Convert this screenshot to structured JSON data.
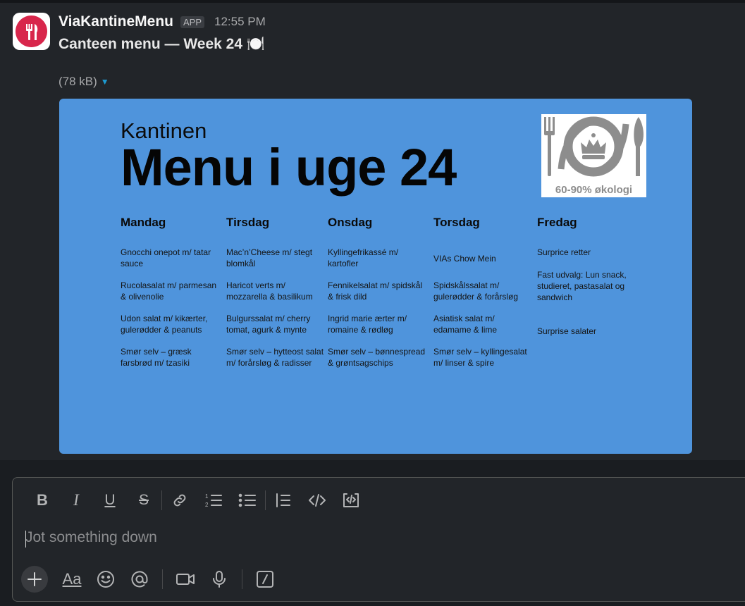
{
  "message": {
    "sender": "ViaKantineMenu",
    "badge": "APP",
    "time": "12:55 PM",
    "text": "Canteen menu — Week 24 🍽️",
    "file_size": "(78 kB)"
  },
  "menu": {
    "subtitle": "Kantinen",
    "title": "Menu i uge 24",
    "eco_label": "60-90% økologi",
    "days": [
      {
        "name": "Mandag",
        "dishes": [
          "Gnocchi onepot m/ tatar sauce",
          "Rucolasalat m/ parmesan & olivenolie",
          "Udon salat m/ kikærter, gulerødder & peanuts",
          "Smør selv – græsk farsbrød m/ tzasiki"
        ]
      },
      {
        "name": "Tirsdag",
        "dishes": [
          "Mac’n’Cheese m/ stegt blomkål",
          "Haricot verts m/ mozzarella & basilikum",
          "Bulgurssalat m/ cherry tomat, agurk & mynte",
          "Smør selv – hytteost salat m/ forårsløg & radisser"
        ]
      },
      {
        "name": "Onsdag",
        "dishes": [
          "Kyllingefrikassé m/ kartofler",
          "Fennikelsalat m/ spidskål & frisk dild",
          "Ingrid marie ærter m/ romaine & rødløg",
          "Smør selv – bønnespread & grøntsagschips"
        ]
      },
      {
        "name": "Torsdag",
        "dishes": [
          "VIAs Chow Mein",
          "Spidskålssalat m/ gulerødder & forårsløg",
          "Asiatisk salat m/ edamame & lime",
          "Smør selv – kyllingesalat m/ linser & spire"
        ]
      },
      {
        "name": "Fredag",
        "dishes": [
          "Surprice retter",
          "Fast udvalg: Lun snack, studieret, pastasalat og sandwich",
          "",
          "Surprise salater"
        ]
      }
    ]
  },
  "composer": {
    "placeholder": "Jot something down",
    "formatting": [
      "bold-icon",
      "italic-icon",
      "underline-icon",
      "strikethrough-icon",
      "link-icon",
      "ordered-list-icon",
      "bulleted-list-icon",
      "blockquote-icon",
      "code-icon",
      "code-block-icon"
    ],
    "actions": [
      "plus-icon",
      "text-format-icon",
      "emoji-icon",
      "mention-icon",
      "video-icon",
      "microphone-icon",
      "slash-command-icon"
    ]
  },
  "colors": {
    "attachment_bg": "#4f94dc",
    "avatar_red": "#d8264b",
    "accent": "#1d9bd1"
  }
}
